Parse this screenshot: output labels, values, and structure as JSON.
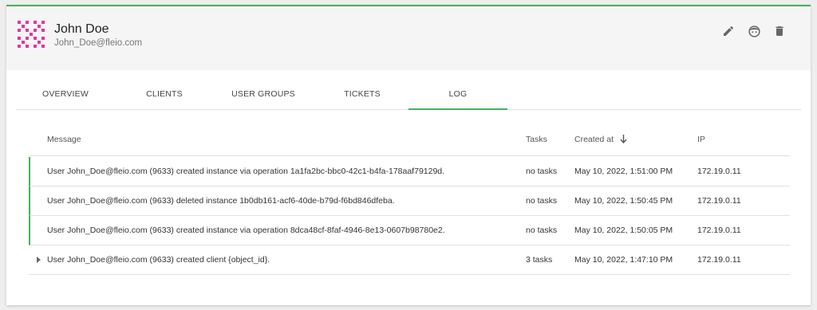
{
  "colors": {
    "accent": "#46b15a",
    "avatar": "#e0389b",
    "icon": "#666666"
  },
  "user": {
    "name": "John Doe",
    "email": "John_Doe@fleio.com"
  },
  "actions": [
    {
      "icon": "pencil-icon"
    },
    {
      "icon": "face-icon"
    },
    {
      "icon": "trash-icon"
    }
  ],
  "tabs": {
    "overview": "OVERVIEW",
    "clients": "CLIENTS",
    "user_groups": "USER GROUPS",
    "tickets": "TICKETS",
    "log": "LOG",
    "active": "LOG"
  },
  "table": {
    "headers": {
      "message": "Message",
      "tasks": "Tasks",
      "created_at": "Created at",
      "ip": "IP"
    },
    "sort_icon": "arrow-down-icon",
    "rows": [
      {
        "message": "User John_Doe@fleio.com (9633) created instance via operation 1a1fa2bc-bbc0-42c1-b4fa-178aaf79129d.",
        "tasks": "no tasks",
        "created_at": "May 10, 2022, 1:51:00 PM",
        "ip": "172.19.0.11"
      },
      {
        "message": "User John_Doe@fleio.com (9633) deleted instance 1b0db161-acf6-40de-b79d-f6bd846dfeba.",
        "tasks": "no tasks",
        "created_at": "May 10, 2022, 1:50:45 PM",
        "ip": "172.19.0.11"
      },
      {
        "message": "User John_Doe@fleio.com (9633) created instance via operation 8dca48cf-8faf-4946-8e13-0607b98780e2.",
        "tasks": "no tasks",
        "created_at": "May 10, 2022, 1:50:05 PM",
        "ip": "172.19.0.11"
      },
      {
        "message": "User John_Doe@fleio.com (9633) created client {object_id}.",
        "tasks": "3 tasks",
        "created_at": "May 10, 2022, 1:47:10 PM",
        "ip": "172.19.0.11"
      }
    ]
  }
}
